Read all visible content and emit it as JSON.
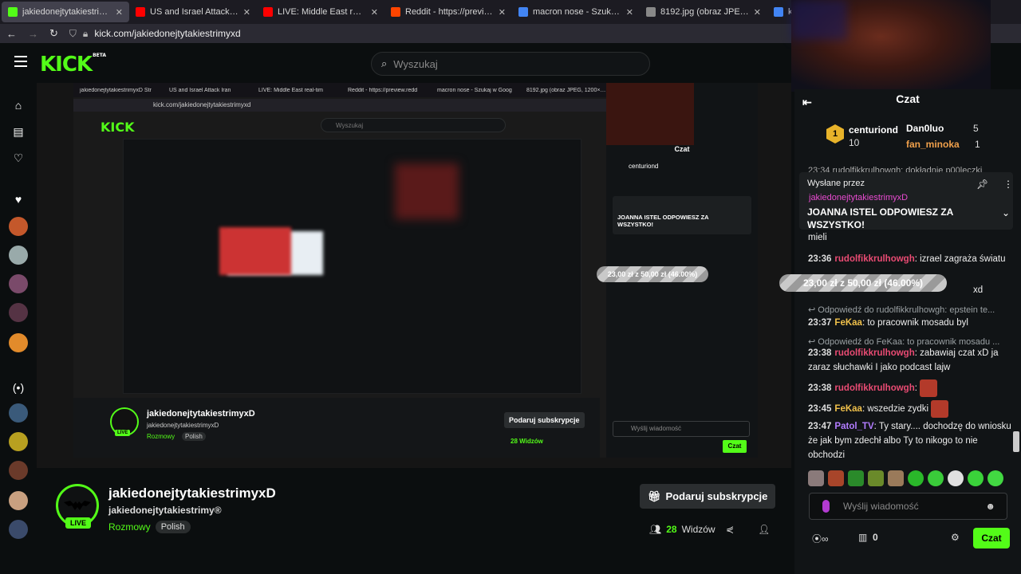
{
  "browser": {
    "tabs": [
      {
        "label": "jakiedonejtytakiestrimyxD Str",
        "color": "#53fc18",
        "active": true
      },
      {
        "label": "US and Israel Attack Iran",
        "color": "#ff0000",
        "active": false
      },
      {
        "label": "LIVE: Middle East real-tim",
        "color": "#ff0000",
        "active": false
      },
      {
        "label": "Reddit - https://preview.redd",
        "color": "#ff4500",
        "active": false
      },
      {
        "label": "macron nose - Szukaj w Goog",
        "color": "#4285f4",
        "active": false
      },
      {
        "label": "8192.jpg (obraz JPEG, 1200×1200",
        "color": "#888888",
        "active": false
      },
      {
        "label": "ka",
        "color": "#4285f4",
        "active": false
      }
    ],
    "url": "kick.com/jakiedonejtytakiestrimyxd"
  },
  "header": {
    "logo": "KICK",
    "logo_badge": "BETA",
    "search_placeholder": "Wyszukaj"
  },
  "stream": {
    "streamer": "jakiedonejtytakiestrimyxD",
    "handle": "jakiedonejtytakiestrimy®",
    "category": "Rozmowy",
    "tag": "Polish",
    "live": "LIVE",
    "subscribe_label": "Podaruj subskrypcje",
    "viewers_count": "28",
    "viewers_label": "Widzów",
    "goal_text": "23,00 zł z 50,00 zł (46.00%)",
    "goal_fraction": 0.46
  },
  "chat": {
    "title": "Czat",
    "leaders": {
      "first_name": "centuriond",
      "first_count": "10",
      "first_rank": "1",
      "second_name": "Dan0luo",
      "second_count": "5",
      "third_name": "fan_minoka",
      "third_count": "1"
    },
    "pinned": {
      "label": "Wysłane przez",
      "user": "jakiedonejtytakiestrimyxD",
      "text": "JOANNA ISTEL ODPOWIESZ ZA WSZYSTKO!"
    },
    "partial_top": "23:34 rudolfikkrulhowgh: dokładnie p00leczki",
    "mieli": "mieli",
    "messages": [
      {
        "time": "23:36",
        "user": "rudolfikkrulhowgh",
        "text": ": izrael zagraża światu"
      },
      {
        "reply": "Odpowiedź do rudolfikkrulhowgh: epstein te..."
      },
      {
        "time": "23:37",
        "user": "FeKaa",
        "text": ": to pracownik mosadu byl"
      },
      {
        "reply": "Odpowiedź do FeKaa: to pracownik mosadu ..."
      },
      {
        "time": "23:38",
        "user": "rudolfikkrulhowgh",
        "text": ": zabawiaj czat xD ja zaraz słuchawki I jako podcast lajw"
      },
      {
        "time": "23:38",
        "user": "rudolfikkrulhowgh",
        "text": ":"
      },
      {
        "time": "23:45",
        "user": "FeKaa",
        "text": ": wszedzie zydki"
      },
      {
        "time": "23:47",
        "user": "Patol_TV",
        "text": ": Ty stary.... dochodzę do wniosku że jak bym zdechł albo Ty to nikogo to nie obchodzi"
      }
    ],
    "overlay_behind": "xd",
    "input_placeholder": "Wyślij wiadomość",
    "points": "0",
    "send_label": "Czat"
  },
  "nested": {
    "title": "jakiedonejtytakiestrimyxD",
    "handle": "jakiedonejtytakiestrimyxD",
    "category": "Rozmowy",
    "tag": "Polish",
    "viewers": "28 Widzów",
    "subscribe": "Podaruj subskrypcje",
    "chat_title": "Czat",
    "chat_send": "Czat",
    "chat_input": "Wyślij wiadomość"
  }
}
